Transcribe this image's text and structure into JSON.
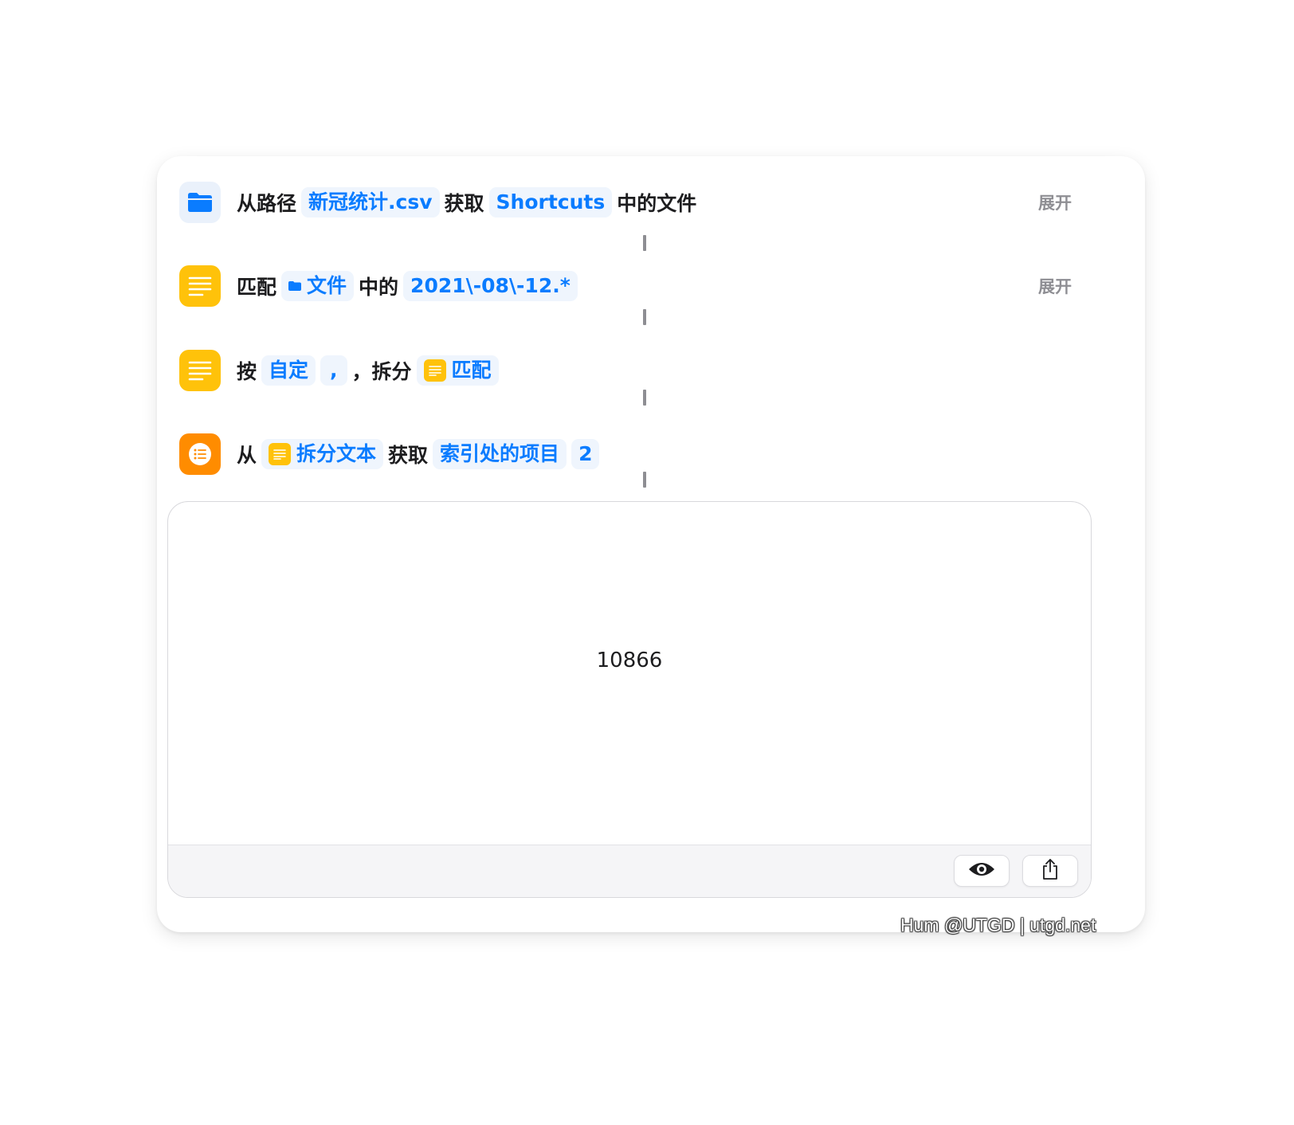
{
  "actions": {
    "get_file": {
      "words": [
        "从路径",
        "获取",
        "中的文件"
      ],
      "path": "新冠统计.csv",
      "location": "Shortcuts",
      "expand_label": "展开",
      "icon": "folder-icon"
    },
    "match_text": {
      "words": [
        "匹配",
        "中的"
      ],
      "input_var": "文件",
      "pattern": "2021\\-08\\-12.*",
      "expand_label": "展开",
      "icon": "text-lines-icon"
    },
    "split_text": {
      "words": [
        "按",
        "，拆分"
      ],
      "separator": "自定",
      "separator_value": ",",
      "input_var": "匹配",
      "icon": "text-lines-icon"
    },
    "get_item": {
      "words": [
        "从",
        "获取"
      ],
      "input_var": "拆分文本",
      "mode": "索引处的项目",
      "index": "2",
      "icon": "list-icon"
    }
  },
  "result": {
    "value": "10866",
    "toolbar": {
      "quicklook_icon": "eye-icon",
      "share_icon": "share-icon"
    }
  },
  "watermark": "Hum @UTGD | utgd.net",
  "colors": {
    "accent": "#0a7cff",
    "token_bg": "#eff5fd",
    "text_icon": "#ffc20a",
    "list_icon": "#ff8c00",
    "files_icon": "#0a7cff"
  }
}
